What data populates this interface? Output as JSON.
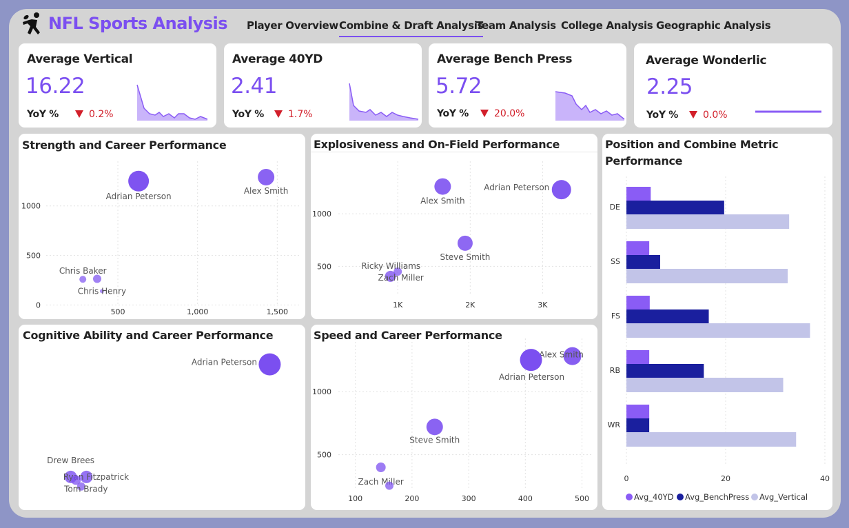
{
  "app": {
    "title": "NFL Sports Analysis"
  },
  "nav": {
    "items": [
      {
        "label": "Player Overview"
      },
      {
        "label": "Combine & Draft Analysis",
        "active": true
      },
      {
        "label": "Team Analysis"
      },
      {
        "label": "College Analysis"
      },
      {
        "label": "Geographic Analysis"
      }
    ]
  },
  "kpis": [
    {
      "title": "Average Vertical",
      "value": "16.22",
      "yoy_label": "YoY %",
      "delta": "0.2%",
      "direction": "down"
    },
    {
      "title": "Average 40YD",
      "value": "2.41",
      "yoy_label": "YoY %",
      "delta": "1.7%",
      "direction": "down"
    },
    {
      "title": "Average Bench Press",
      "value": "5.72",
      "yoy_label": "YoY %",
      "delta": "20.0%",
      "direction": "down"
    },
    {
      "title": "Average Wonderlic",
      "value": "2.25",
      "yoy_label": "YoY %",
      "delta": "0.0%",
      "direction": "down"
    }
  ],
  "colors": {
    "accent": "#7b4ff0",
    "negative": "#d21f2a",
    "navy": "#1a1f9e",
    "lavender": "#c2c4e8"
  },
  "panels": {
    "strength": {
      "title": "Strength and Career Performance"
    },
    "explosive": {
      "title": "Explosiveness and On-Field Performance"
    },
    "position": {
      "title": "Position and Combine Metric Performance"
    },
    "cognitive": {
      "title": "Cognitive Ability and Career Performance"
    },
    "speed": {
      "title": "Speed and Career Performance"
    }
  },
  "chart_data": [
    {
      "type": "scatter",
      "id": "strength",
      "xticks": [
        "500",
        "1,000",
        "1,500"
      ],
      "yticks": [
        "0",
        "500",
        "1000"
      ],
      "xlim": [
        50,
        1650
      ],
      "ylim": [
        -10,
        1450
      ],
      "points": [
        {
          "label": "Adrian Peterson",
          "x": 630,
          "y": 1250,
          "size": 15
        },
        {
          "label": "Alex Smith",
          "x": 1430,
          "y": 1290,
          "size": 12
        },
        {
          "label": "Chris Baker",
          "x": 280,
          "y": 260,
          "size": 5
        },
        {
          "label": "",
          "x": 370,
          "y": 265,
          "size": 6
        },
        {
          "label": "Chris Henry",
          "x": 400,
          "y": 140,
          "size": 3
        }
      ]
    },
    {
      "type": "scatter",
      "id": "explosive",
      "xticks": [
        "1K",
        "2K",
        "3K"
      ],
      "yticks": [
        "500",
        "1000"
      ],
      "xlim": [
        180,
        3700
      ],
      "ylim": [
        220,
        1500
      ],
      "points": [
        {
          "label": "Alex Smith",
          "x": 1620,
          "y": 1260,
          "size": 12
        },
        {
          "label": "Adrian Peterson",
          "x": 3260,
          "y": 1230,
          "size": 14
        },
        {
          "label": "Steve Smith",
          "x": 1930,
          "y": 720,
          "size": 11
        },
        {
          "label": "Ricky Williams",
          "x": 1000,
          "y": 450,
          "size": 6
        },
        {
          "label": "Zach Miller",
          "x": 900,
          "y": 405,
          "size": 8
        }
      ]
    },
    {
      "type": "scatter",
      "id": "cognitive",
      "xticks": [],
      "yticks": [],
      "xlim": [
        0,
        100
      ],
      "ylim": [
        0,
        100
      ],
      "points": [
        {
          "label": "Adrian Peterson",
          "x": 88,
          "y": 88,
          "size": 16
        },
        {
          "label": "Drew Brees",
          "x": 12,
          "y": 17,
          "size": 9
        },
        {
          "label": "Ryan Fitzpatrick",
          "x": 18,
          "y": 17,
          "size": 9
        },
        {
          "label": "",
          "x": 14,
          "y": 15,
          "size": 7
        },
        {
          "label": "Tom Brady",
          "x": 16,
          "y": 11,
          "size": 6
        }
      ]
    },
    {
      "type": "scatter",
      "id": "speed",
      "xticks": [
        "100",
        "200",
        "300",
        "400",
        "500"
      ],
      "yticks": [
        "500",
        "1000"
      ],
      "xlim": [
        70,
        520
      ],
      "ylim": [
        220,
        1420
      ],
      "points": [
        {
          "label": "Alex Smith",
          "x": 483,
          "y": 1280,
          "size": 13
        },
        {
          "label": "Adrian Peterson",
          "x": 410,
          "y": 1250,
          "size": 16
        },
        {
          "label": "Steve Smith",
          "x": 240,
          "y": 720,
          "size": 12
        },
        {
          "label": "Zach Miller",
          "x": 145,
          "y": 400,
          "size": 7
        },
        {
          "label": "",
          "x": 160,
          "y": 255,
          "size": 6
        }
      ]
    },
    {
      "type": "bar",
      "id": "position",
      "orientation": "horizontal",
      "categories": [
        "DE",
        "SS",
        "FS",
        "RB",
        "WR"
      ],
      "xticks": [
        "0",
        "20",
        "40"
      ],
      "xlim": [
        0,
        40
      ],
      "series": [
        {
          "name": "Avg_40YD",
          "color": "#8a5cf5",
          "values": [
            4.9,
            4.6,
            4.7,
            4.6,
            4.6
          ]
        },
        {
          "name": "Avg_BenchPress",
          "color": "#1a1f9e",
          "values": [
            19.7,
            6.8,
            16.6,
            15.6,
            4.6
          ]
        },
        {
          "name": "Avg_Vertical",
          "color": "#c2c4e8",
          "values": [
            32.8,
            32.5,
            37.0,
            31.6,
            34.2
          ]
        }
      ]
    }
  ]
}
